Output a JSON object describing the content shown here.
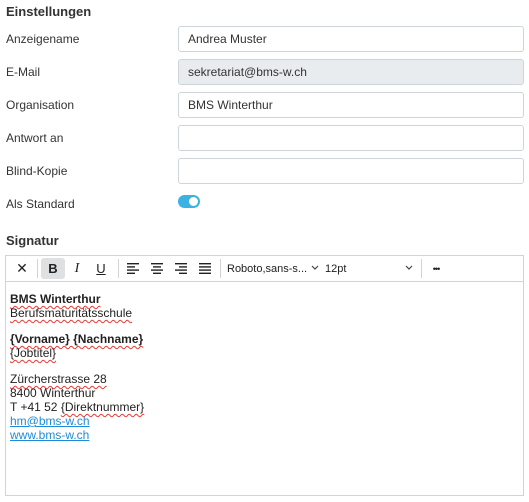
{
  "settings": {
    "title": "Einstellungen",
    "display_name": {
      "label": "Anzeigename",
      "value": "Andrea Muster"
    },
    "email": {
      "label": "E-Mail",
      "value": "sekretariat@bms-w.ch"
    },
    "organisation": {
      "label": "Organisation",
      "value": "BMS Winterthur"
    },
    "reply_to": {
      "label": "Antwort an",
      "value": ""
    },
    "bcc": {
      "label": "Blind-Kopie",
      "value": ""
    },
    "default": {
      "label": "Als Standard",
      "enabled": true
    }
  },
  "signature": {
    "title": "Signatur",
    "toolbar": {
      "clear_icon": "✕",
      "bold_icon": "B",
      "italic_icon": "I",
      "underline_icon": "U",
      "align_left_icon": "align-left-icon",
      "align_center_icon": "align-center-icon",
      "align_right_icon": "align-right-icon",
      "align_justify_icon": "align-justify-icon",
      "font_family": "Roboto,sans-s...",
      "font_size": "12pt",
      "more_icon": "•••"
    },
    "content": {
      "org_name": "BMS Winterthur",
      "school": "Berufsmaturitätsschule",
      "name_placeholder": "{Vorname} {Nachname}",
      "jobtitle_placeholder": "{Jobtitel}",
      "street": "Zürcherstrasse 28",
      "city": "8400 Winterthur",
      "phone_prefix": "T +41 52 ",
      "phone_placeholder": "{Direktnummer}",
      "email": "hm@bms-w.ch",
      "website": "www.bms-w.ch"
    }
  },
  "colors": {
    "accent": "#3ab3e3",
    "link": "#1f8bd8",
    "readonly_bg": "#e9ecef",
    "border": "#cfd4da"
  }
}
